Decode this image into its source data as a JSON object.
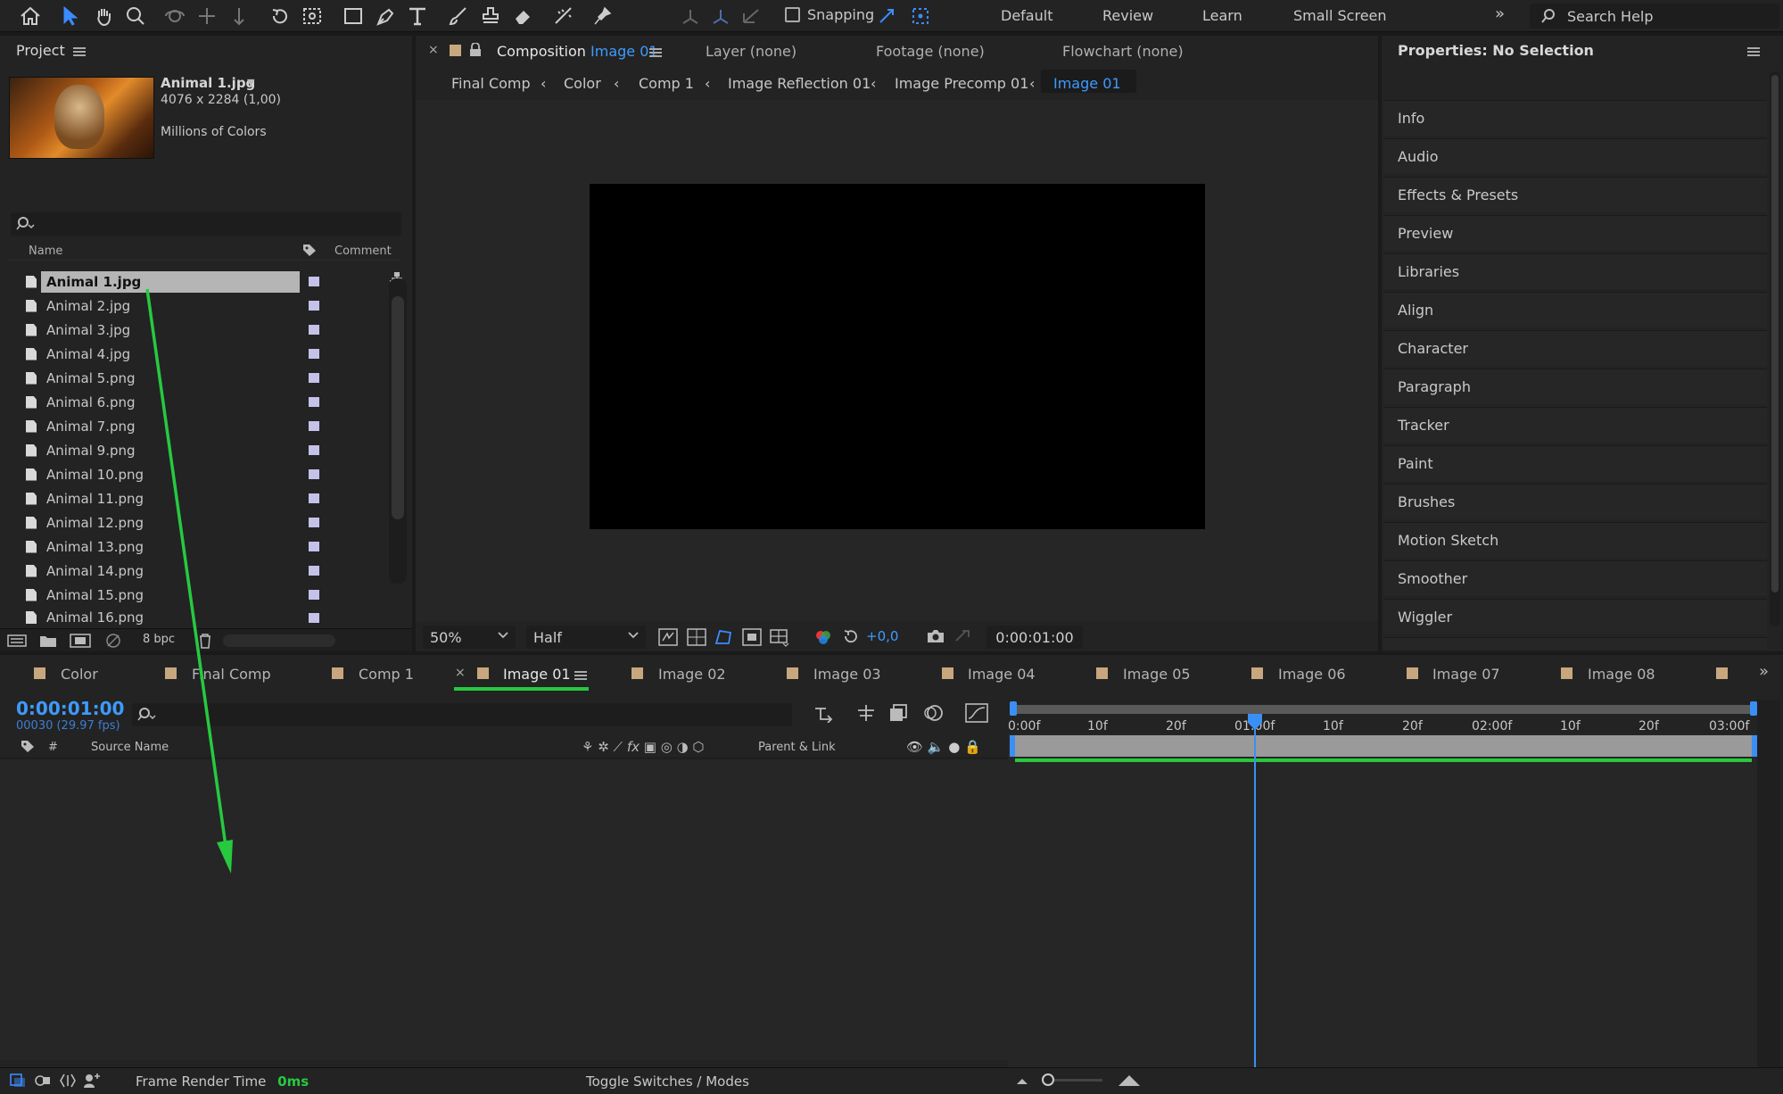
{
  "toolbar": {
    "snapping_label": "Snapping",
    "workspaces": [
      "Default",
      "Review",
      "Learn",
      "Small Screen"
    ],
    "search_placeholder": "Search Help"
  },
  "project": {
    "title": "Project",
    "file": {
      "name": "Animal 1.jpg",
      "dims": "4076 x 2284 (1,00)",
      "colors": "Millions of Colors"
    },
    "columns": {
      "name": "Name",
      "comment": "Comment"
    },
    "items": [
      "Animal 1.jpg",
      "Animal 2.jpg",
      "Animal 3.jpg",
      "Animal 4.jpg",
      "Animal 5.png",
      "Animal 6.png",
      "Animal 7.png",
      "Animal 9.png",
      "Animal 10.png",
      "Animal 11.png",
      "Animal 12.png",
      "Animal 13.png",
      "Animal 14.png",
      "Animal 15.png",
      "Animal 16.png"
    ],
    "selected_index": 0,
    "bpc": "8 bpc"
  },
  "viewer": {
    "tabs": {
      "composition_prefix": "Composition",
      "composition_name": "Image 01",
      "layer": "Layer (none)",
      "footage": "Footage (none)",
      "flowchart": "Flowchart (none)"
    },
    "breadcrumbs": [
      "Final Comp",
      "Color",
      "Comp 1",
      "Image Reflection 01",
      "Image Precomp 01",
      "Image 01"
    ],
    "zoom": "50%",
    "resolution": "Half",
    "exposure": "+0,0",
    "timecode": "0:00:01:00"
  },
  "properties": {
    "title": "Properties: No Selection",
    "panels": [
      "Info",
      "Audio",
      "Effects & Presets",
      "Preview",
      "Libraries",
      "Align",
      "Character",
      "Paragraph",
      "Tracker",
      "Paint",
      "Brushes",
      "Motion Sketch",
      "Smoother",
      "Wiggler"
    ]
  },
  "timeline": {
    "tabs": [
      "Color",
      "Final Comp",
      "Comp 1",
      "Image 01",
      "Image 02",
      "Image 03",
      "Image 04",
      "Image 05",
      "Image 06",
      "Image 07",
      "Image 08"
    ],
    "active_tab": "Image 01",
    "timecode": "0:00:01:00",
    "frames": "00030 (29.97 fps)",
    "columns": {
      "number": "#",
      "source": "Source Name",
      "parent": "Parent & Link"
    },
    "ruler": [
      "0:00f",
      "10f",
      "20f",
      "01:00f",
      "10f",
      "20f",
      "02:00f",
      "10f",
      "20f",
      "03:00f"
    ],
    "frame_render_label": "Frame Render Time",
    "frame_render_value": "0ms",
    "toggle_label": "Toggle Switches / Modes"
  },
  "colors": {
    "accent_blue": "#3b8cff",
    "annotation_green": "#27c93f",
    "label_tan": "#c8a77e",
    "label_lavender": "#c4c2e8"
  }
}
